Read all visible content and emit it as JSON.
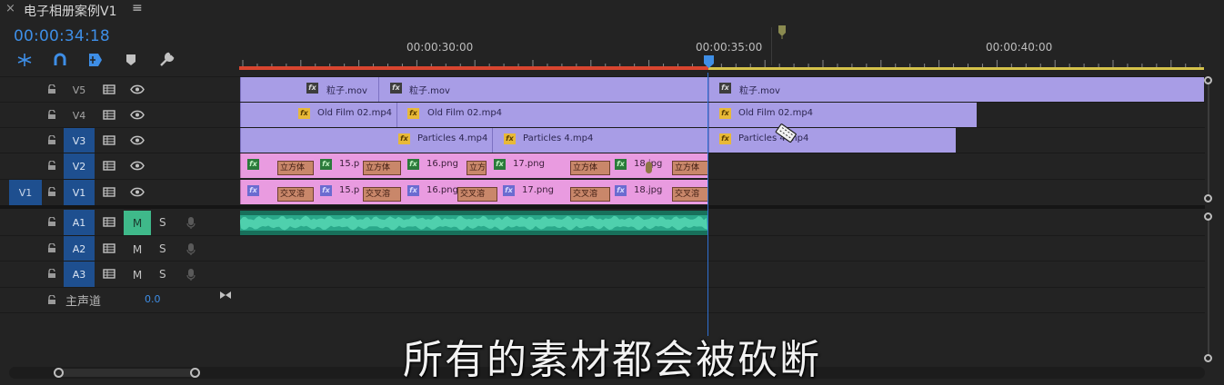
{
  "panel": {
    "close": "×",
    "title": "电子相册案例V1",
    "menu_icon": "≡"
  },
  "timecode": "00:00:34:18",
  "ruler": {
    "labels": [
      "00:00:30:00",
      "00:00:35:00",
      "00:00:40:00"
    ]
  },
  "tracks": {
    "v5": "V5",
    "v4": "V4",
    "v3": "V3",
    "v2": "V2",
    "v1": "V1",
    "v1_source": "V1",
    "a1": "A1",
    "a2": "A2",
    "a3": "A3",
    "mute": "M",
    "solo": "S",
    "master_label": "主声道",
    "master_value": "0.0"
  },
  "clips": {
    "v5": [
      "粒子.mov",
      "粒子.mov",
      "粒子.mov"
    ],
    "v4": [
      "Old Film 02.mp4",
      "Old Film 02.mp4",
      "Old Film 02.mp4"
    ],
    "v3": [
      "Particles 4.mp4",
      "Particles 4.mp4",
      "Particles 4.mp4"
    ],
    "v2": [
      "15.p",
      "16.png",
      "17.png",
      "18.jpg"
    ],
    "v2_trans": [
      "立方体",
      "立方体",
      "立方",
      "立方体",
      "立方体"
    ],
    "v1": [
      "15.p",
      "16.png",
      "17.png",
      "18.jpg"
    ],
    "v1_trans": [
      "交叉溶",
      "交叉溶",
      "交叉溶",
      "交叉溶",
      "交叉溶"
    ]
  },
  "fx_label": "fx",
  "subtitle": "所有的素材都会被砍断",
  "colors": {
    "accent": "#3e8ee6",
    "video_clip": "#a89de6",
    "image_clip": "#e99be0",
    "audio_clip": "#18705b",
    "work_area": "#d8452f",
    "mute_on": "#3fb98a"
  },
  "icons": [
    "snap-icon",
    "linked-selection-icon",
    "add-marker-icon",
    "marker-icon",
    "wrench-icon",
    "lock-icon",
    "film-icon",
    "eye-icon",
    "mic-icon",
    "razor-icon"
  ]
}
